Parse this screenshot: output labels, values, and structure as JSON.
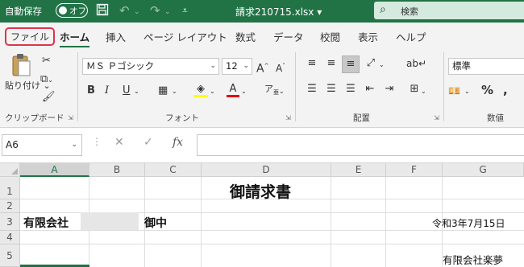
{
  "titlebar": {
    "autosave_label": "自動保存",
    "autosave_state": "オフ",
    "filename": "請求210715.xlsx",
    "search_label": "検索"
  },
  "tabs": [
    {
      "label": "ファイル"
    },
    {
      "label": "ホーム"
    },
    {
      "label": "挿入"
    },
    {
      "label": "ページ レイアウト"
    },
    {
      "label": "数式"
    },
    {
      "label": "データ"
    },
    {
      "label": "校閲"
    },
    {
      "label": "表示"
    },
    {
      "label": "ヘルプ"
    }
  ],
  "ribbon": {
    "clipboard": {
      "paste_label": "貼り付け",
      "group_label": "クリップボード"
    },
    "font": {
      "font_name": "ＭＳ Ｐゴシック",
      "font_size": "12",
      "group_label": "フォント"
    },
    "alignment": {
      "group_label": "配置"
    },
    "number": {
      "format": "標準",
      "group_label": "数値"
    }
  },
  "formula_bar": {
    "name_box": "A6",
    "fx_label": "fx",
    "formula": ""
  },
  "grid": {
    "columns": [
      "A",
      "B",
      "C",
      "D",
      "E",
      "F",
      "G"
    ],
    "selected_column": "A",
    "rows": [
      "1",
      "2",
      "3",
      "4",
      "5"
    ],
    "cells": {
      "d1": "御請求書",
      "a3": "有限会社",
      "c3": "御中",
      "g3": "令和3年7月15日",
      "g5": "有限会社楽夢"
    }
  },
  "colors": {
    "accent": "#217346",
    "file_outline": "#e0334a",
    "highlight": "#ffff00",
    "font_red": "#e00000"
  }
}
